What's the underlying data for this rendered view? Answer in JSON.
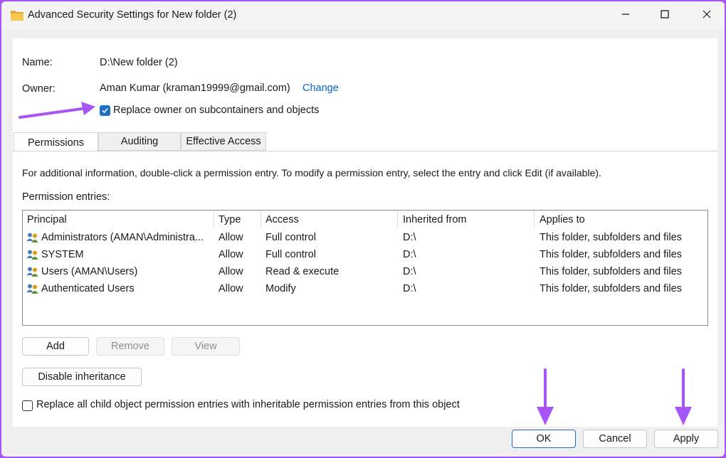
{
  "window": {
    "title": "Advanced Security Settings for New folder (2)",
    "minimize_icon": "minimize-icon",
    "maximize_icon": "maximize-icon",
    "close_icon": "close-icon"
  },
  "fields": {
    "name_label": "Name:",
    "name_value": "D:\\New folder (2)",
    "owner_label": "Owner:",
    "owner_value": "Aman Kumar (kraman19999@gmail.com)",
    "change_link": "Change",
    "replace_owner_label": "Replace owner on subcontainers and objects",
    "replace_owner_checked": true
  },
  "tabs": [
    {
      "label": "Permissions",
      "active": true
    },
    {
      "label": "Auditing",
      "active": false
    },
    {
      "label": "Effective Access",
      "active": false
    }
  ],
  "permissions": {
    "info_text": "For additional information, double-click a permission entry. To modify a permission entry, select the entry and click Edit (if available).",
    "entries_label": "Permission entries:",
    "columns": [
      "Principal",
      "Type",
      "Access",
      "Inherited from",
      "Applies to"
    ],
    "rows": [
      {
        "principal": "Administrators (AMAN\\Administra...",
        "type": "Allow",
        "access": "Full control",
        "inherited_from": "D:\\",
        "applies_to": "This folder, subfolders and files"
      },
      {
        "principal": "SYSTEM",
        "type": "Allow",
        "access": "Full control",
        "inherited_from": "D:\\",
        "applies_to": "This folder, subfolders and files"
      },
      {
        "principal": "Users (AMAN\\Users)",
        "type": "Allow",
        "access": "Read & execute",
        "inherited_from": "D:\\",
        "applies_to": "This folder, subfolders and files"
      },
      {
        "principal": "Authenticated Users",
        "type": "Allow",
        "access": "Modify",
        "inherited_from": "D:\\",
        "applies_to": "This folder, subfolders and files"
      }
    ],
    "row_icon": "users-icon"
  },
  "buttons": {
    "add": "Add",
    "remove": "Remove",
    "view": "View",
    "disable_inheritance": "Disable inheritance",
    "ok": "OK",
    "cancel": "Cancel",
    "apply": "Apply"
  },
  "replace_child": {
    "label": "Replace all child object permission entries with inheritable permission entries from this object",
    "checked": false
  },
  "colors": {
    "annotation_arrow": "#a855f7",
    "accent": "#1f6fc5",
    "link": "#0a66c2"
  }
}
